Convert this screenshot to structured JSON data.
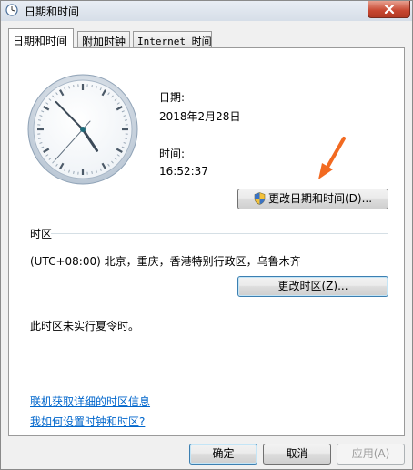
{
  "window": {
    "title": "日期和时间"
  },
  "tabs": [
    {
      "label": "日期和时间",
      "active": true
    },
    {
      "label": "附加时钟",
      "active": false
    },
    {
      "label": "Internet 时间",
      "active": false
    }
  ],
  "datetime": {
    "date_label": "日期:",
    "date_value": "2018年2月28日",
    "time_label": "时间:",
    "time_value": "16:52:37",
    "change_button": "更改日期和时间(D)..."
  },
  "clock": {
    "hour": 16,
    "minute": 52,
    "second": 37
  },
  "timezone": {
    "section_label": "时区",
    "value": "(UTC+08:00) 北京，重庆，香港特别行政区，乌鲁木齐",
    "change_button": "更改时区(Z)...",
    "dst_note": "此时区未实行夏令时。"
  },
  "links": {
    "online_info": "联机获取详细的时区信息",
    "how_to_set": "我如何设置时钟和时区?"
  },
  "footer": {
    "ok": "确定",
    "cancel": "取消",
    "apply": "应用(A)"
  },
  "colors": {
    "accent_arrow": "#f26a21",
    "link": "#0066cc",
    "close_button": "#c7462f"
  },
  "icons": {
    "title": "clock-icon",
    "shield": "uac-shield-icon",
    "close": "close-icon",
    "annotation": "arrow-icon"
  }
}
